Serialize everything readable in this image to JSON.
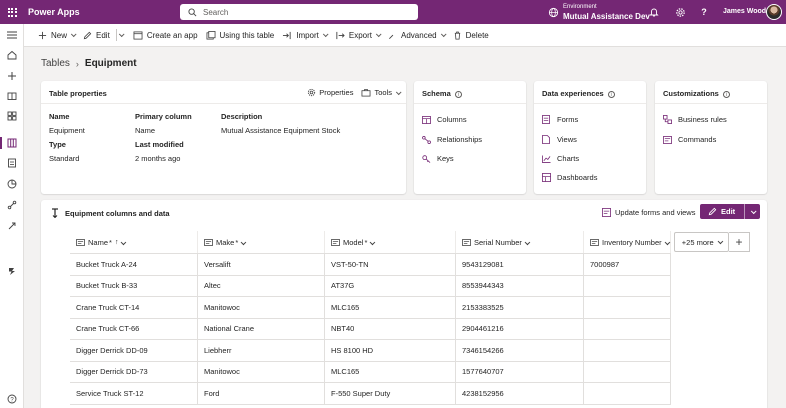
{
  "topbar": {
    "app_name": "Power Apps",
    "search_placeholder": "Search",
    "environment_label": "Environment",
    "environment_name": "Mutual Assistance Dev",
    "user_name": "James Wood"
  },
  "commands": {
    "new": "New",
    "edit": "Edit",
    "create_app": "Create an app",
    "using_table": "Using this table",
    "import": "Import",
    "export": "Export",
    "advanced": "Advanced",
    "delete": "Delete"
  },
  "breadcrumb": {
    "root": "Tables",
    "separator": "›",
    "current": "Equipment"
  },
  "table_properties": {
    "title": "Table properties",
    "properties_label": "Properties",
    "tools_label": "Tools",
    "name_label": "Name",
    "name_value": "Equipment",
    "primary_column_label": "Primary column",
    "primary_column_value": "Name",
    "description_label": "Description",
    "description_value": "Mutual Assistance Equipment Stock",
    "type_label": "Type",
    "type_value": "Standard",
    "last_modified_label": "Last modified",
    "last_modified_value": "2 months ago"
  },
  "schema": {
    "title": "Schema",
    "items": [
      "Columns",
      "Relationships",
      "Keys"
    ]
  },
  "data_experiences": {
    "title": "Data experiences",
    "items": [
      "Forms",
      "Views",
      "Charts",
      "Dashboards"
    ]
  },
  "customizations": {
    "title": "Customizations",
    "items": [
      "Business rules",
      "Commands"
    ]
  },
  "data_section": {
    "title": "Equipment columns and data",
    "update_link": "Update forms and views",
    "edit_button": "Edit",
    "more_columns": "+25 more",
    "add_column": "+",
    "columns": [
      {
        "label": "Name",
        "required": "*",
        "sort": "↑"
      },
      {
        "label": "Make",
        "required": "*",
        "sort": ""
      },
      {
        "label": "Model",
        "required": "*",
        "sort": ""
      },
      {
        "label": "Serial Number",
        "required": "",
        "sort": ""
      },
      {
        "label": "Inventory Number",
        "required": "",
        "sort": ""
      }
    ],
    "rows": [
      [
        "Bucket Truck A-24",
        "Versalift",
        "VST-50-TN",
        "9543129081",
        "7000987"
      ],
      [
        "Bucket Truck B-33",
        "Altec",
        "AT37G",
        "8553944343",
        ""
      ],
      [
        "Crane Truck CT-14",
        "Manitowoc",
        "MLC165",
        "2153383525",
        ""
      ],
      [
        "Crane Truck CT-66",
        "National Crane",
        "NBT40",
        "2904461216",
        ""
      ],
      [
        "Digger Derrick DD-09",
        "Liebherr",
        "HS 8100 HD",
        "7346154266",
        ""
      ],
      [
        "Digger Derrick DD-73",
        "Manitowoc",
        "MLC165",
        "1577640707",
        ""
      ],
      [
        "Service Truck ST-12",
        "Ford",
        "F-550 Super Duty",
        "4238152956",
        ""
      ]
    ]
  },
  "colors": {
    "brand": "#742774",
    "link_icon": "#742774"
  }
}
